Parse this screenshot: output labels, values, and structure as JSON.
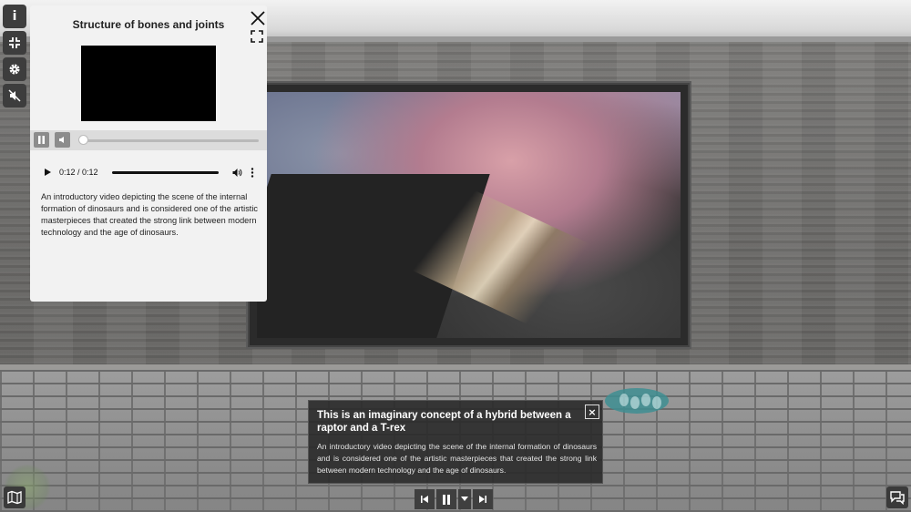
{
  "toolbar": {
    "buttons": [
      {
        "icon": "info-icon",
        "glyph": "i"
      },
      {
        "icon": "collapse-icon"
      },
      {
        "icon": "gear-icon"
      },
      {
        "icon": "mute-icon"
      }
    ]
  },
  "info_panel": {
    "title": "Structure of bones and joints",
    "video_progress": 0.0,
    "audio": {
      "current_time": "0:12",
      "duration": "0:12",
      "time_display": "0:12 / 0:12",
      "progress": 1.0
    },
    "description": "An introductory video depicting the scene of the internal formation of dinosaurs and is considered one of the artistic masterpieces that created the strong link between modern technology and the age of dinosaurs."
  },
  "caption": {
    "title": "This is an imaginary concept of a hybrid between a raptor and a T-rex",
    "close_glyph": "×",
    "text": "An introductory video depicting the scene of the internal formation of dinosaurs and is considered one of the artistic masterpieces that created the strong link between modern technology and the age of dinosaurs."
  },
  "media_controls": [
    "previous-icon",
    "pause-icon",
    "dropdown-icon",
    "next-icon"
  ],
  "colors": {
    "panel_bg": "#f2f2f2",
    "caption_bg": "#282828",
    "toolbar_bg": "#3d3d3d",
    "footprint_teal": "#3f8f93"
  }
}
